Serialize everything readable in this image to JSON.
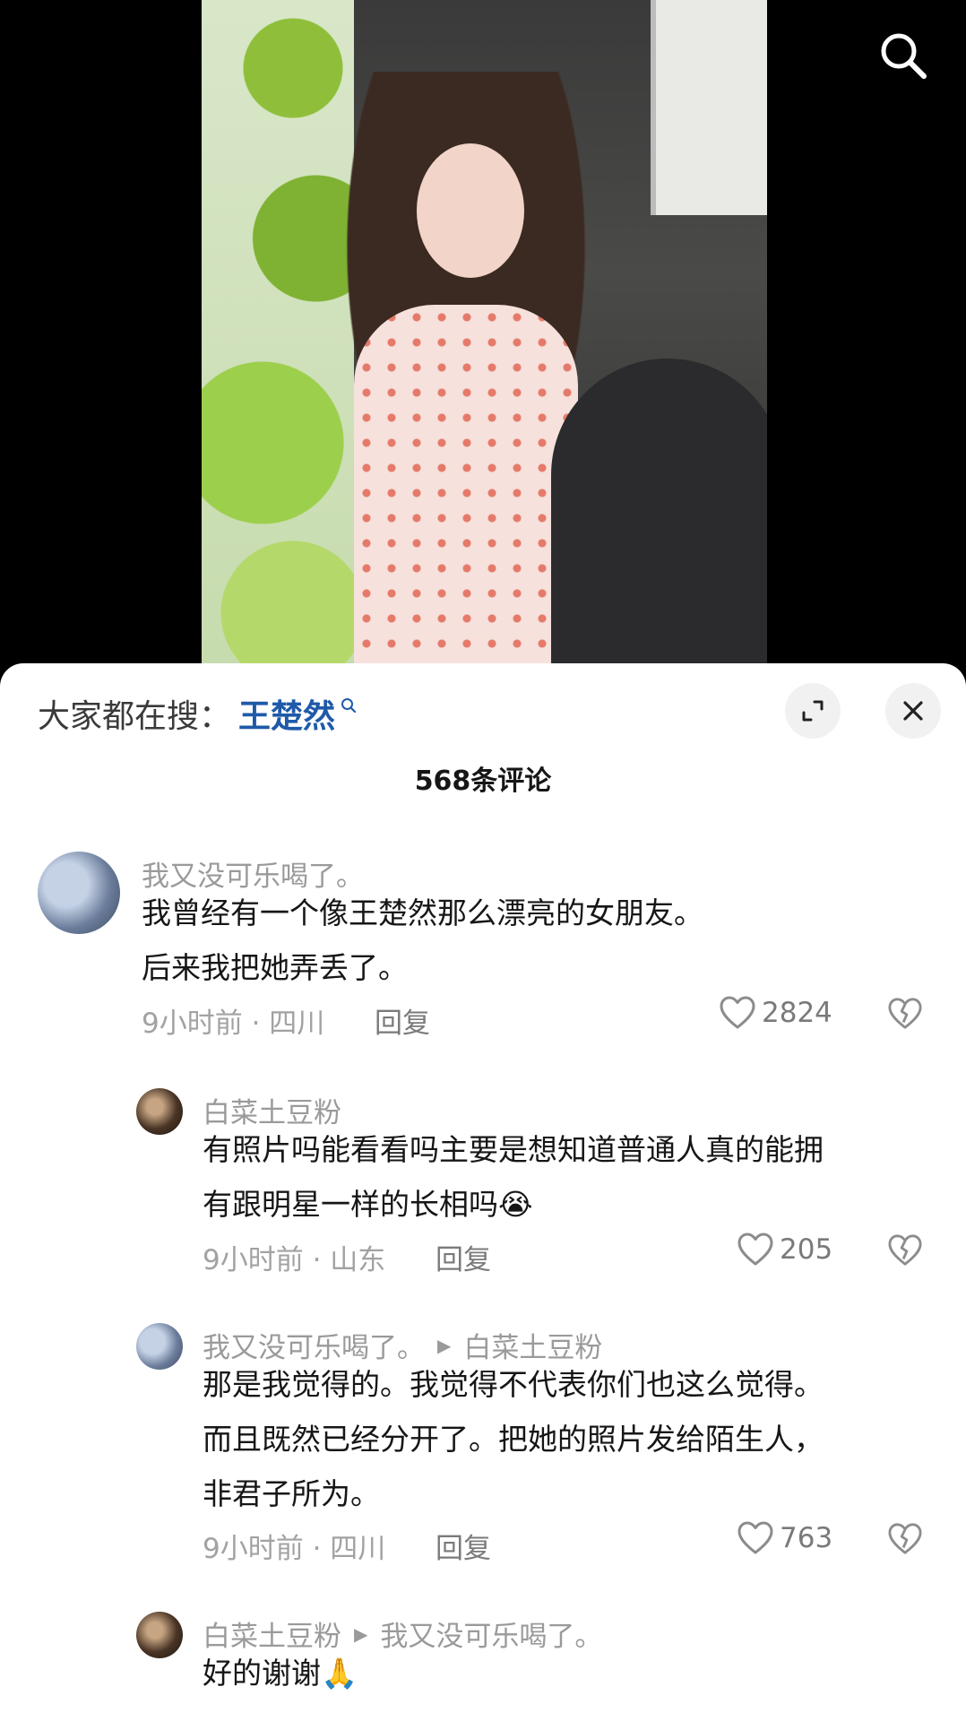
{
  "top": {
    "search_icon": "search-icon"
  },
  "sheet": {
    "trend_label": "大家都在搜：",
    "trend_keyword": "王楚然",
    "comment_count": "568条评论",
    "accent": "#1f5aa8"
  },
  "comments": [
    {
      "user": "我又没可乐喝了。",
      "text_lines": [
        "我曾经有一个像王楚然那么漂亮的女朋友。",
        "后来我把她弄丢了。"
      ],
      "time_location": "9小时前 · 四川",
      "reply": "回复",
      "likes": "2824"
    },
    {
      "user": "白菜土豆粉",
      "text_lines": [
        "有照片吗能看看吗主要是想知道普通人真的能拥",
        "有跟明星一样的长相吗😭"
      ],
      "time_location": "9小时前 · 山东",
      "reply": "回复",
      "likes": "205"
    },
    {
      "user": "我又没可乐喝了。",
      "reply_to": "白菜土豆粉",
      "text_lines": [
        "那是我觉得的。我觉得不代表你们也这么觉得。",
        "而且既然已经分开了。把她的照片发给陌生人，",
        "非君子所为。"
      ],
      "time_location": "9小时前 · 四川",
      "reply": "回复",
      "likes": "763"
    },
    {
      "user": "白菜土豆粉",
      "reply_to": "我又没可乐喝了。",
      "text_lines": [
        "好的谢谢🙏"
      ]
    }
  ]
}
